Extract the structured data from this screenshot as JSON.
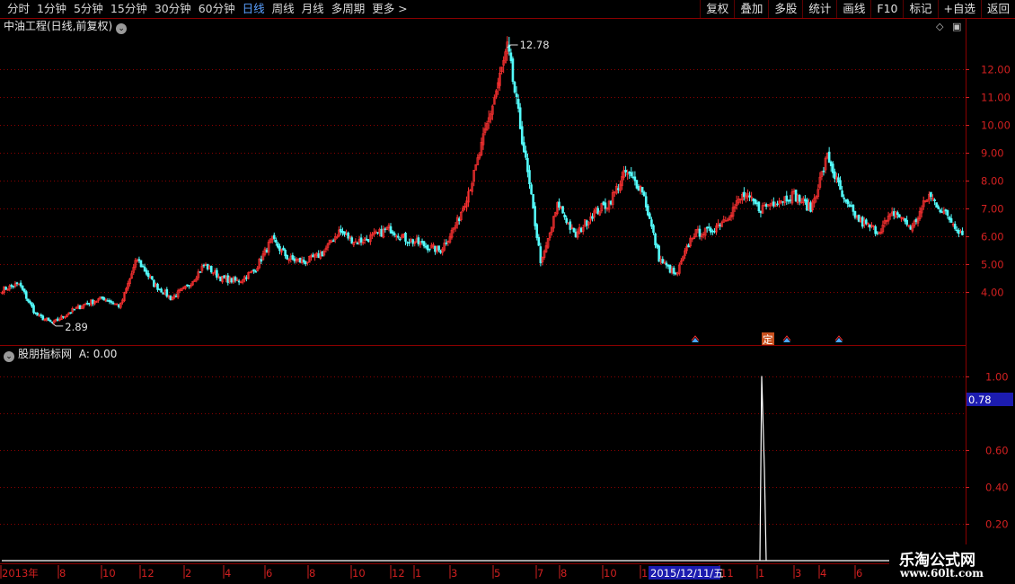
{
  "toolbar": {
    "periods": [
      "分时",
      "1分钟",
      "5分钟",
      "15分钟",
      "30分钟",
      "60分钟",
      "日线",
      "周线",
      "月线",
      "多周期",
      "更多 >"
    ],
    "active_period": "日线",
    "actions": [
      "复权",
      "叠加",
      "多股",
      "统计",
      "画线",
      "F10",
      "标记",
      "+自选",
      "返回"
    ]
  },
  "main_panel": {
    "title": "中油工程(日线,前复权)",
    "high_label": "12.78",
    "low_label": "2.89",
    "signal_badge": "定"
  },
  "indicator_panel": {
    "title": "股朋指标网",
    "value_text": "A: 0.00",
    "current_value": "0.78"
  },
  "date_cursor": "2015/12/11/五",
  "watermark": {
    "line1": "乐淘公式网",
    "line2": "www.60lt.com"
  },
  "colors": {
    "up": "#ff3232",
    "down": "#54fcfc",
    "grid": "#8b0000",
    "axis_text": "#d22020",
    "accent": "#3c3cff"
  },
  "chart_data": [
    {
      "type": "candlestick",
      "title": "中油工程(日线,前复权)",
      "y_ticks": [
        "12.00",
        "11.00",
        "10.00",
        "9.00",
        "8.00",
        "7.00",
        "6.00",
        "5.00",
        "4.00"
      ],
      "ylim": [
        2.5,
        13.2
      ],
      "x_ticks": [
        "2013年",
        "8",
        "10",
        "12",
        "2",
        "4",
        "6",
        "8",
        "10",
        "12",
        "1",
        "3",
        "5",
        "7",
        "8",
        "10",
        "1",
        "11",
        "1",
        "3",
        "4",
        "6"
      ],
      "series": [
        {
          "name": "close",
          "values": [
            4.1,
            4.3,
            3.2,
            2.89,
            3.3,
            3.6,
            3.8,
            3.5,
            5.2,
            4.3,
            3.8,
            4.2,
            5.0,
            4.5,
            4.4,
            4.8,
            5.9,
            5.2,
            5.1,
            5.4,
            6.2,
            5.8,
            6.0,
            6.3,
            5.9,
            5.7,
            5.5,
            6.5,
            8.2,
            10.5,
            12.78,
            9.0,
            5.0,
            7.2,
            6.0,
            6.8,
            7.2,
            8.3,
            7.7,
            5.2,
            4.6,
            6.1,
            6.2,
            6.7,
            7.5,
            7.0,
            7.3,
            7.5,
            7.0,
            8.9,
            7.2,
            6.5,
            6.2,
            6.9,
            6.3,
            7.5,
            6.8,
            6.1
          ]
        }
      ],
      "annotations": [
        {
          "text": "12.78",
          "kind": "max"
        },
        {
          "text": "2.89",
          "kind": "min"
        }
      ]
    },
    {
      "type": "line",
      "title": "股朋指标网",
      "y_ticks": [
        "1.00",
        "0.60",
        "0.40",
        "0.20"
      ],
      "ylim": [
        0,
        1.1
      ],
      "series": [
        {
          "name": "A",
          "values": [
            0,
            0,
            0,
            0,
            0,
            0,
            0,
            0,
            0,
            0,
            0,
            0,
            0,
            0,
            0,
            0,
            0,
            0,
            0,
            0,
            0,
            0,
            0,
            0,
            0,
            0,
            0,
            0,
            0,
            0,
            0,
            0,
            0,
            0,
            0,
            0,
            0,
            0,
            0,
            0,
            0,
            0,
            0,
            0,
            0,
            0,
            0,
            0,
            1.0,
            0.5,
            0,
            0,
            0,
            0,
            0,
            0,
            0,
            0
          ]
        }
      ]
    }
  ]
}
